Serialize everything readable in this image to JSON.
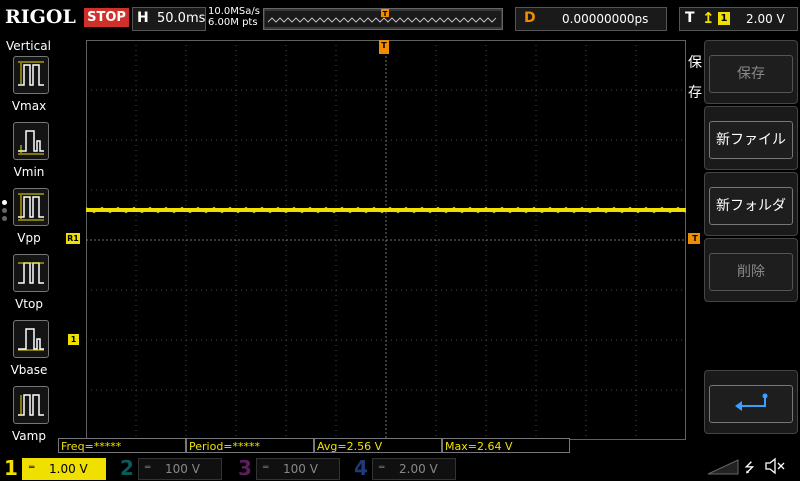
{
  "header": {
    "logo": "RIGOL",
    "run_status": "STOP",
    "horizontal_key": "H",
    "timebase": "50.0ms",
    "sample_rate": "10.0MSa/s",
    "memory_depth": "6.00M pts",
    "delay_key": "D",
    "delay_value": "0.00000000ps",
    "trigger_key": "T",
    "trigger_source": "1",
    "trigger_level": "2.00 V"
  },
  "left_panel": {
    "title": "Vertical",
    "items": [
      {
        "label": "Vmax"
      },
      {
        "label": "Vmin"
      },
      {
        "label": "Vpp"
      },
      {
        "label": "Vtop"
      },
      {
        "label": "Vbase"
      },
      {
        "label": "Vamp"
      }
    ]
  },
  "right_menu": {
    "title": "保存",
    "buttons": [
      {
        "label": "保存",
        "enabled": false
      },
      {
        "label": "新ファイル",
        "enabled": true
      },
      {
        "label": "新フォルダ",
        "enabled": true
      },
      {
        "label": "削除",
        "enabled": false
      }
    ]
  },
  "markers": {
    "ch1_ref": "R1",
    "ch1_offset": "1",
    "trigger_level": "T",
    "trigger_position": "T"
  },
  "measurements": {
    "freq": "Freq=*****",
    "period": "Period=*****",
    "avg": "Avg=2.56 V",
    "max": "Max=2.64 V"
  },
  "channels": [
    {
      "num": "1",
      "scale": "1.00 V",
      "color": "#f0e000",
      "active": true
    },
    {
      "num": "2",
      "scale": "100 V",
      "color": "#00c8c8",
      "active": false
    },
    {
      "num": "3",
      "scale": "100 V",
      "color": "#d040d0",
      "active": false
    },
    {
      "num": "4",
      "scale": "2.00 V",
      "color": "#3070ff",
      "active": false
    }
  ],
  "waveform": {
    "channel": "1",
    "level_fraction_from_top": 0.425,
    "color": "#f0e000"
  },
  "colors": {
    "accent_orange": "#f08c00",
    "ch1_yellow": "#f0e000",
    "stop_red": "#d0302a"
  }
}
